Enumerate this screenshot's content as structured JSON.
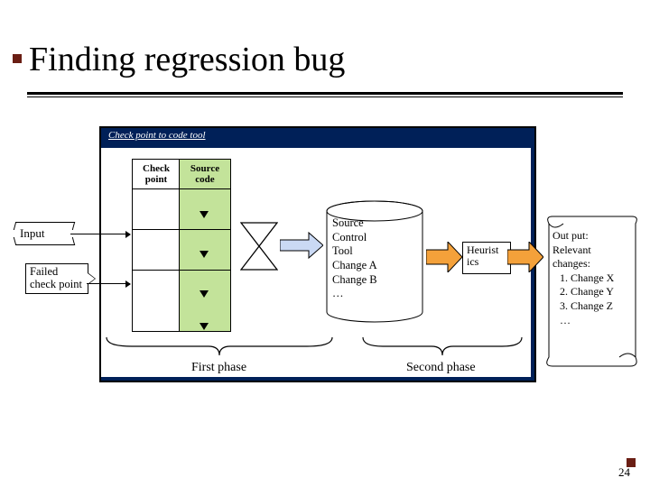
{
  "title": "Finding regression bug",
  "outer_label": "Check point to code tool",
  "columns": {
    "check_point": "Check point",
    "source_code": "Source code"
  },
  "input_label": "Input",
  "failed_label": "Failed check point",
  "cylinder": {
    "line1": "Source",
    "line2": "Control",
    "line3": "Tool",
    "line4": "Change A",
    "line5": "Change B",
    "line6": "…"
  },
  "heuristics": "Heurist ics",
  "output": {
    "h1": "Out put:",
    "h2": "Relevant",
    "h3": "changes:",
    "i1": "1. Change X",
    "i2": "2. Change Y",
    "i3": "3. Change Z",
    "i4": "…"
  },
  "phase1": "First phase",
  "phase2": "Second phase",
  "page_number": "24"
}
